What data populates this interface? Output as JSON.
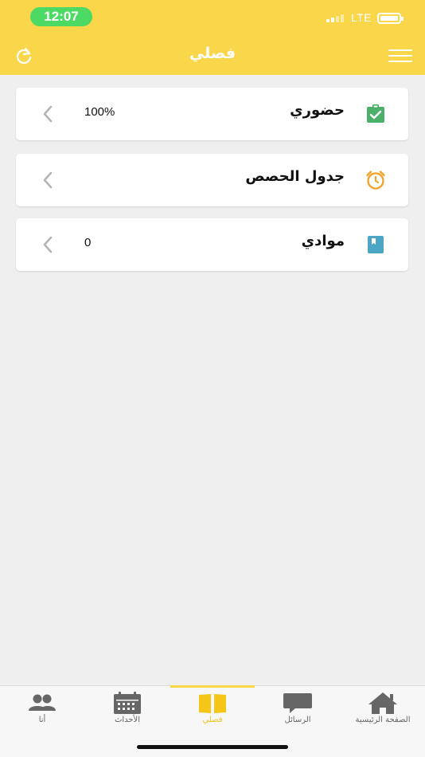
{
  "status_bar": {
    "time": "12:07",
    "network": "LTE",
    "time_pill_color": "#4cd964"
  },
  "navbar": {
    "title": "فصلي",
    "background": "#f9d64a",
    "left_icon": "refresh-icon",
    "right_icon": "hamburger-menu-icon"
  },
  "cards": [
    {
      "label": "حضوري",
      "value": "100%",
      "icon": "attendance-clipboard-icon",
      "icon_color": "#4caf6a"
    },
    {
      "label": "جدول الحصص",
      "value": "",
      "icon": "alarm-clock-icon",
      "icon_color": "#f0a531"
    },
    {
      "label": "موادي",
      "value": "0",
      "icon": "book-icon",
      "icon_color": "#4aa6c4"
    }
  ],
  "tabbar": {
    "active_color": "#f5c518",
    "inactive_color": "#666666",
    "tabs": [
      {
        "label": "أنا",
        "icon": "people-icon"
      },
      {
        "label": "الأحداث",
        "icon": "calendar-icon"
      },
      {
        "label": "فصلي",
        "icon": "open-book-icon",
        "active": true
      },
      {
        "label": "الرسائل",
        "icon": "chat-bubble-icon"
      },
      {
        "label": "الصفحة الرئيسية",
        "icon": "home-icon"
      }
    ]
  }
}
